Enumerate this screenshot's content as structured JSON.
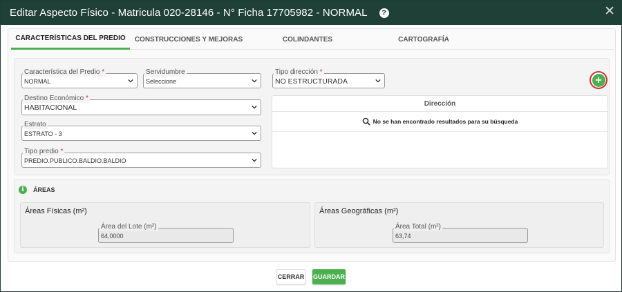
{
  "dialog": {
    "title": "Editar Aspecto Físico - Matricula 020-28146 - N° Ficha 17705982 - NORMAL",
    "help_icon": "?",
    "close_icon": "✕"
  },
  "tabs": [
    {
      "label": "CARACTERÍSTICAS DEL PREDIO",
      "active": true
    },
    {
      "label": "CONSTRUCCIONES Y MEJORAS",
      "active": false
    },
    {
      "label": "COLINDANTES",
      "active": false
    },
    {
      "label": "CARTOGRAFÍA",
      "active": false
    }
  ],
  "form": {
    "caracteristica": {
      "label": "Característica del Predio",
      "value": "NORMAL"
    },
    "servidumbre": {
      "label": "Servidumbre",
      "value": "Seleccione"
    },
    "tipo_direccion": {
      "label": "Tipo dirección",
      "value": "NO ESTRUCTURADA"
    },
    "destino": {
      "label": "Destino Económico",
      "value": "HABITACIONAL"
    },
    "estrato": {
      "label": "Estrato",
      "value": "ESTRATO - 3"
    },
    "tipo_predio": {
      "label": "Tipo predio",
      "value": "PREDIO.PUBLICO.BALDIO.BALDIO"
    },
    "required_mark": "*"
  },
  "add_button": {
    "icon": "+"
  },
  "direccion_table": {
    "header": "Dirección",
    "empty_message": "No se han encontrado resultados para su búsqueda"
  },
  "areas": {
    "title": "ÁREAS",
    "info_icon": "i",
    "fisicas": {
      "title": "Áreas Físicas (m²)",
      "field_label": "Área del Lote (m²)",
      "value": "64,0000"
    },
    "geograficas": {
      "title": "Áreas Geográficas (m²)",
      "field_label": "Área Total (m²)",
      "value": "63,74"
    }
  },
  "footer": {
    "cerrar": "CERRAR",
    "guardar": "GUARDAR"
  },
  "colors": {
    "titlebar": "#1f4037",
    "accent": "#4caf50",
    "required": "#d32f2f"
  }
}
